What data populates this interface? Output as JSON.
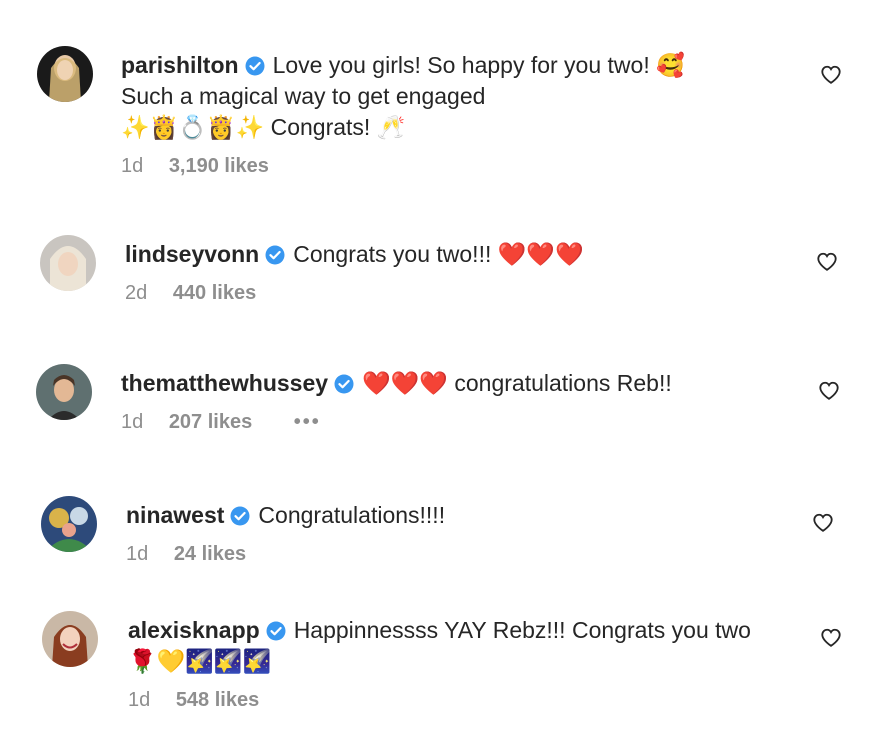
{
  "comments": [
    {
      "username": "parishilton",
      "text": "Love you girls! So happy for you two! 🥰 Such a magical way to get engaged ✨👸💍👸✨ Congrats! 🥂",
      "line1": "Love you girls! So happy for you two! 🥰",
      "line2": "Such a magical way to get engaged",
      "line3": "✨👸💍👸✨ Congrats! 🥂",
      "time": "1d",
      "likes": "3,190 likes"
    },
    {
      "username": "lindseyvonn",
      "text": "Congrats you two!!! ❤️❤️❤️",
      "time": "2d",
      "likes": "440 likes"
    },
    {
      "username": "thematthewhussey",
      "text": "❤️❤️❤️ congratulations Reb!!",
      "time": "1d",
      "likes": "207 likes",
      "more": "•••"
    },
    {
      "username": "ninawest",
      "text": "Congratulations!!!!",
      "time": "1d",
      "likes": "24 likes"
    },
    {
      "username": "alexisknapp",
      "line1": "Happinnessss YAY Rebz!!! Congrats you two",
      "line2": "🌹💛🌠🌠🌠",
      "time": "1d",
      "likes": "548 likes"
    }
  ],
  "colors": {
    "verified": "#3897f0",
    "muted": "#8e8e8e",
    "text": "#262626"
  },
  "icons": [
    "verified-badge-icon",
    "heart-outline-icon",
    "avatar-photo"
  ]
}
